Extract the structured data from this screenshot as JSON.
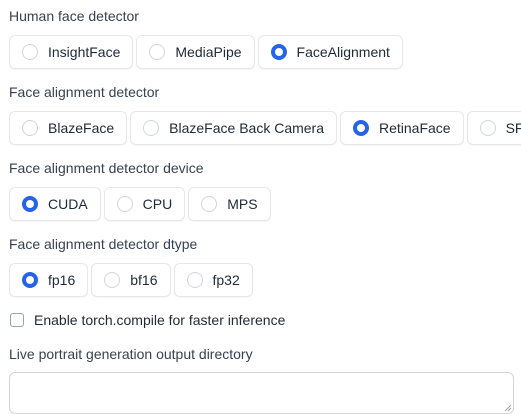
{
  "face_detector": {
    "label": "Human face detector",
    "options": [
      "InsightFace",
      "MediaPipe",
      "FaceAlignment"
    ],
    "selected": "FaceAlignment"
  },
  "alignment_detector": {
    "label": "Face alignment detector",
    "options": [
      "BlazeFace",
      "BlazeFace Back Camera",
      "RetinaFace",
      "SFD"
    ],
    "selected": "RetinaFace"
  },
  "alignment_device": {
    "label": "Face alignment detector device",
    "options": [
      "CUDA",
      "CPU",
      "MPS"
    ],
    "selected": "CUDA"
  },
  "alignment_dtype": {
    "label": "Face alignment detector dtype",
    "options": [
      "fp16",
      "bf16",
      "fp32"
    ],
    "selected": "fp16"
  },
  "torch_compile": {
    "label": "Enable torch.compile for faster inference",
    "checked": false
  },
  "output_dir": {
    "label": "Live portrait generation output directory",
    "value": ""
  },
  "colors": {
    "accent": "#2563eb",
    "border": "#e5e7eb",
    "text": "#1f2937"
  }
}
